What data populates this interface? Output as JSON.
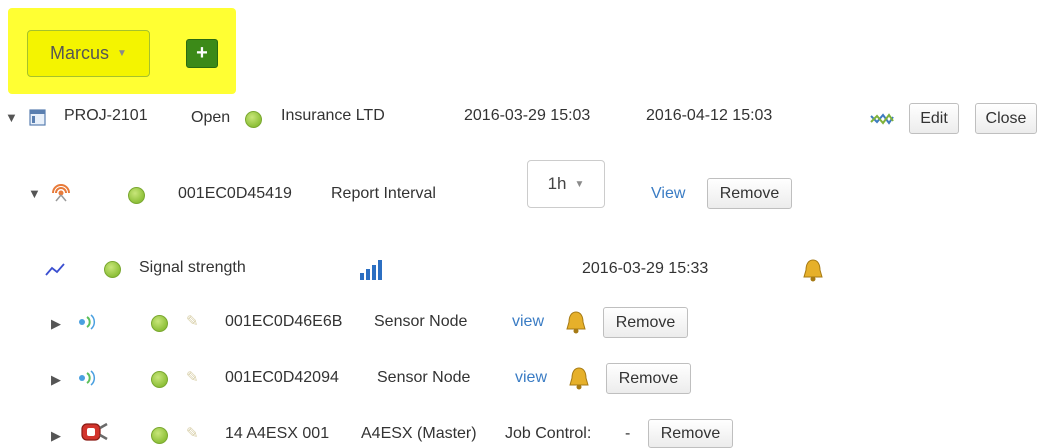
{
  "header": {
    "user_menu_label": "Marcus",
    "add_label": "+"
  },
  "project": {
    "id": "PROJ-2101",
    "status": "Open",
    "customer": "Insurance LTD",
    "start": "2016-03-29 15:03",
    "end": "2016-04-12 15:03",
    "edit_label": "Edit",
    "close_label": "Close"
  },
  "device": {
    "id": "001EC0D45419",
    "name": "Report Interval",
    "interval": "1h",
    "view_label": "View",
    "remove_label": "Remove"
  },
  "signal": {
    "label": "Signal strength",
    "timestamp": "2016-03-29 15:33"
  },
  "nodes": [
    {
      "id": "001EC0D46E6B",
      "name": "Sensor Node",
      "view_label": "view",
      "remove_label": "Remove"
    },
    {
      "id": "001EC0D42094",
      "name": "Sensor Node",
      "view_label": "view",
      "remove_label": "Remove"
    }
  ],
  "master": {
    "id": "14 A4ESX 001",
    "name": "A4ESX (Master)",
    "job_control_label": "Job Control:",
    "job_control_value": "-",
    "remove_label": "Remove"
  },
  "icons": {
    "toggle": "caret-icon",
    "project": "project-icon",
    "gateway": "gateway-icon",
    "chart": "line-chart-icon",
    "signal_bars": "signal-bars-icon",
    "bell": "bell-icon",
    "sensor": "sensor-icon",
    "edit": "pencil-icon",
    "plug": "plug-icon"
  },
  "colors": {
    "highlight": "#ffff33",
    "status_ok": "#8fc13a",
    "add_button": "#3c8a18",
    "link": "#3a7cc4"
  }
}
